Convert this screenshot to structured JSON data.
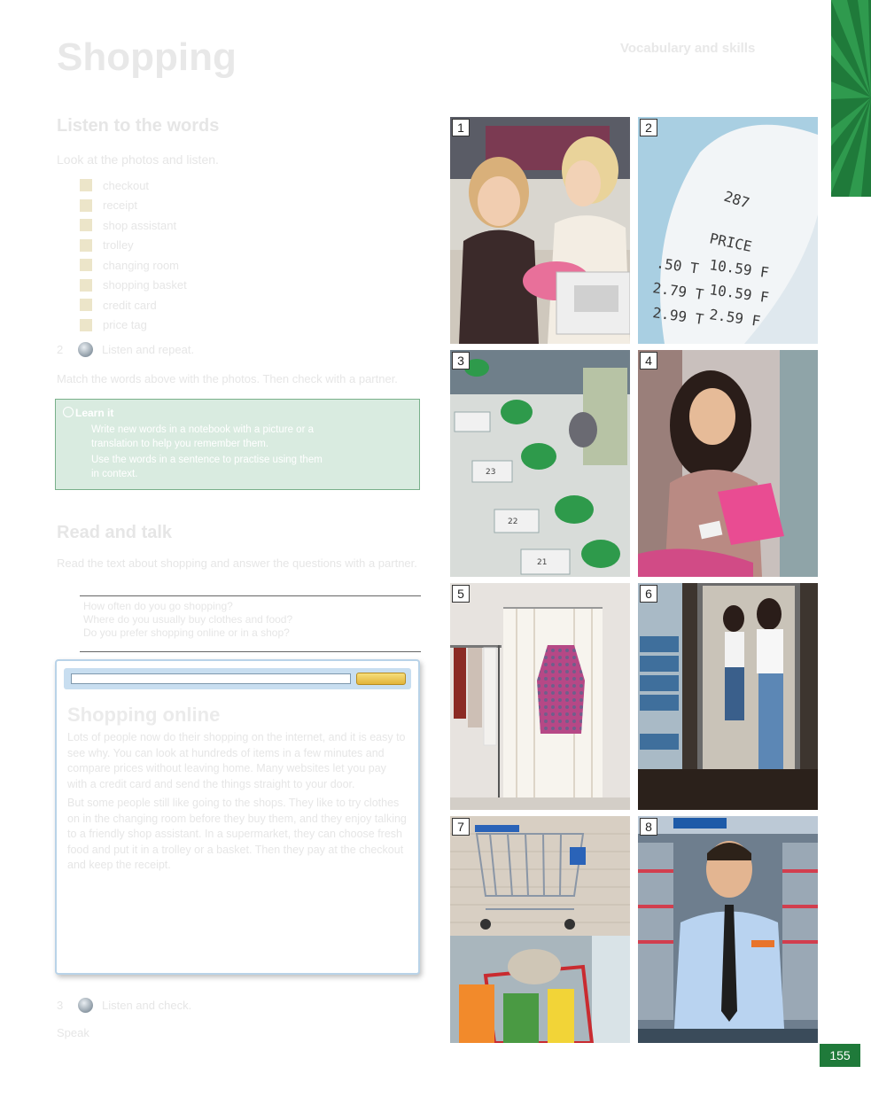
{
  "page": {
    "title": "Shopping",
    "top_right": "Vocabulary and skills",
    "page_number": "155"
  },
  "section1": {
    "heading": "Listen to the words",
    "instruction": "Look at the photos and listen.",
    "items": [
      "checkout",
      "receipt",
      "shop assistant",
      "trolley",
      "changing room",
      "shopping basket",
      "credit card",
      "price tag"
    ],
    "audio1": {
      "number": "2",
      "label": "Listen and repeat."
    },
    "task": "Match the words above with the photos. Then check with a partner."
  },
  "tip": {
    "title": "Learn it",
    "lines": [
      "Write new words in a notebook with a picture or a",
      "translation to help you remember them.",
      "Use the words in a sentence to practise using them",
      "in context."
    ]
  },
  "section2": {
    "heading": "Read and talk",
    "instruction": "Read the text about shopping and answer the questions with a partner.",
    "ruled_lines": [
      "How often do you go shopping?",
      "Where do you usually buy clothes and food?",
      "Do you prefer shopping online or in a shop?"
    ]
  },
  "article": {
    "search_value": "",
    "button_label": "",
    "heading": "Shopping online",
    "paragraphs": [
      "Lots of people now do their shopping on the internet, and it is easy to see why. You can look at hundreds of items in a few minutes and compare prices without leaving home. Many websites let you pay with a credit card and send the things straight to your door.",
      "But some people still like going to the shops. They like to try clothes on in the changing room before they buy them, and they enjoy talking to a friendly shop assistant. In a supermarket, they can choose fresh food and put it in a trolley or a basket. Then they pay at the checkout and keep the receipt."
    ]
  },
  "audio2": {
    "number": "3",
    "label": "Listen and check."
  },
  "footer_word": "Speak",
  "photos": [
    {
      "number": "1",
      "alt": "two women at a shop counter"
    },
    {
      "number": "2",
      "alt": "receipt with prices"
    },
    {
      "number": "3",
      "alt": "supermarket checkouts"
    },
    {
      "number": "4",
      "alt": "woman paying with a card"
    },
    {
      "number": "5",
      "alt": "dress at a changing room curtain"
    },
    {
      "number": "6",
      "alt": "women trying on jeans at a mirror"
    },
    {
      "number": "7",
      "alt": "shopping trolley and basket"
    },
    {
      "number": "8",
      "alt": "shop assistant in a store"
    }
  ],
  "colors": {
    "brand_green": "#1f7a3a",
    "tip_bg": "#d9ebe0",
    "article_border": "#b9d3e8"
  }
}
